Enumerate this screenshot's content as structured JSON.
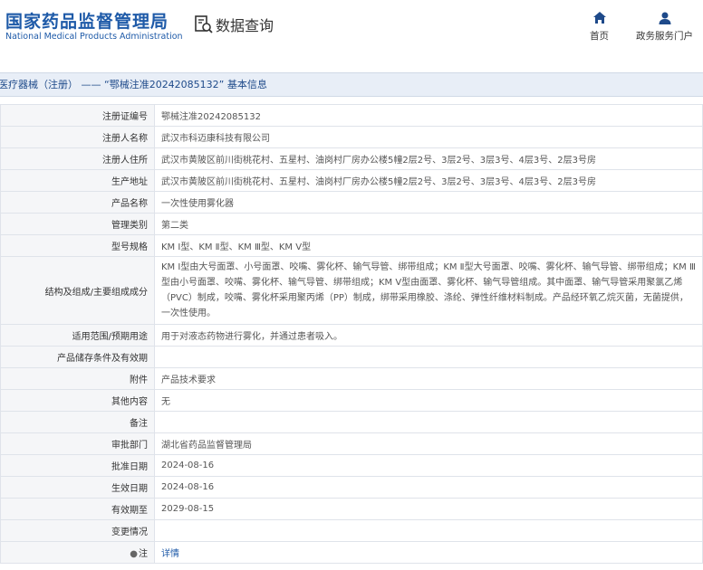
{
  "header": {
    "logo_cn": "国家药品监督管理局",
    "logo_en": "National Medical Products Administration",
    "query_label": "数据查询",
    "nav": [
      {
        "label": "首页",
        "icon": "home-icon"
      },
      {
        "label": "政务服务门户",
        "icon": "user-icon"
      }
    ]
  },
  "breadcrumb": "医疗器械（注册） —— “鄂械注准20242085132” 基本信息",
  "rows": [
    {
      "label": "注册证编号",
      "value": "鄂械注准20242085132"
    },
    {
      "label": "注册人名称",
      "value": "武汉市科迈康科技有限公司"
    },
    {
      "label": "注册人住所",
      "value": "武汉市黄陂区前川街桃花村、五星村、油岗村厂房办公楼5幢2层2号、3层2号、3层3号、4层3号、2层3号房"
    },
    {
      "label": "生产地址",
      "value": "武汉市黄陂区前川街桃花村、五星村、油岗村厂房办公楼5幢2层2号、3层2号、3层3号、4层3号、2层3号房"
    },
    {
      "label": "产品名称",
      "value": "一次性使用雾化器"
    },
    {
      "label": "管理类别",
      "value": "第二类"
    },
    {
      "label": "型号规格",
      "value": "KM Ⅰ型、KM Ⅱ型、KM Ⅲ型、KM Ⅴ型"
    },
    {
      "label": "结构及组成/主要组成成分",
      "value": "KM Ⅰ型由大号面罩、小号面罩、咬嘴、雾化杯、输气导管、绑带组成；KM Ⅱ型大号面罩、咬嘴、雾化杯、输气导管、绑带组成；KM Ⅲ型由小号面罩、咬嘴、雾化杯、输气导管、绑带组成；KM Ⅴ型由面罩、雾化杯、输气导管组成。其中面罩、输气导管采用聚氯乙烯（PVC）制成，咬嘴、雾化杯采用聚丙烯（PP）制成，绑带采用橡胶、涤纶、弹性纤维材料制成。产品经环氧乙烷灭菌，无菌提供，一次性使用。"
    },
    {
      "label": "适用范围/预期用途",
      "value": "用于对液态药物进行雾化，并通过患者吸入。"
    },
    {
      "label": "产品储存条件及有效期",
      "value": ""
    },
    {
      "label": "附件",
      "value": "产品技术要求"
    },
    {
      "label": "其他内容",
      "value": "无"
    },
    {
      "label": "备注",
      "value": ""
    },
    {
      "label": "审批部门",
      "value": "湖北省药品监督管理局"
    },
    {
      "label": "批准日期",
      "value": "2024-08-16"
    },
    {
      "label": "生效日期",
      "value": "2024-08-16"
    },
    {
      "label": "有效期至",
      "value": "2029-08-15"
    },
    {
      "label": "变更情况",
      "value": ""
    }
  ],
  "note": {
    "label": "注",
    "value": "详情",
    "icon": "bulb-icon"
  },
  "colors": {
    "brand": "#1e5aa8",
    "crumb_bg": "#e8eef7",
    "label_bg": "#f5f6f8",
    "border": "#dfe3ea"
  }
}
